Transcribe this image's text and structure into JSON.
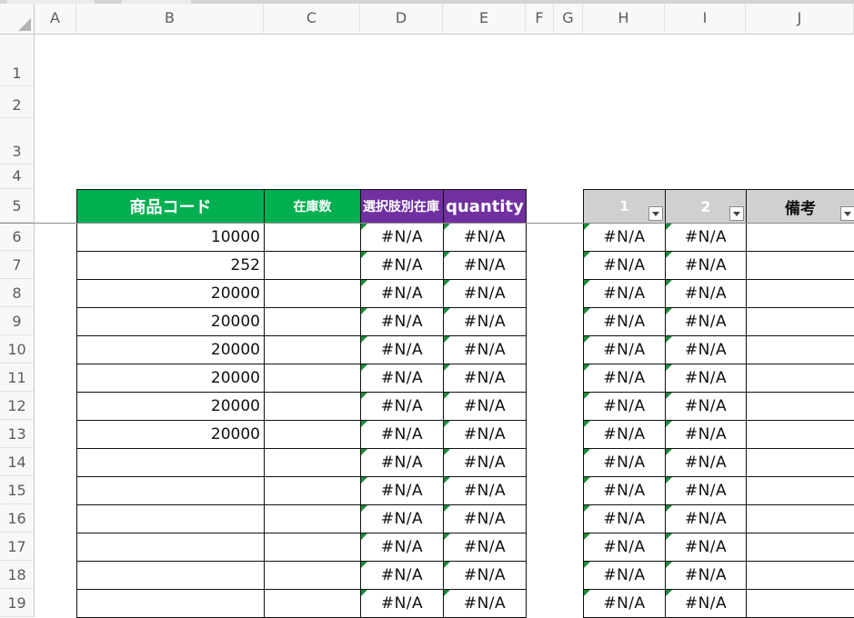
{
  "columns": [
    "A",
    "B",
    "C",
    "D",
    "E",
    "F",
    "G",
    "H",
    "I",
    "J"
  ],
  "rows": [
    "1",
    "2",
    "3",
    "4",
    "5",
    "6",
    "7",
    "8",
    "9",
    "10",
    "11",
    "12",
    "13",
    "14",
    "15",
    "16",
    "17",
    "18",
    "19"
  ],
  "table1": {
    "headers": {
      "product_code": "商品コード",
      "stock": "在庫数",
      "option_stock": "選択肢別在庫",
      "quantity": "quantity"
    },
    "product_codes": [
      "10000",
      "252",
      "20000",
      "20000",
      "20000",
      "20000",
      "20000",
      "20000",
      "",
      "",
      "",
      "",
      "",
      ""
    ],
    "stock_values": [
      "",
      "",
      "",
      "",
      "",
      "",
      "",
      "",
      "",
      "",
      "",
      "",
      "",
      ""
    ],
    "option_stock_values": [
      "#N/A",
      "#N/A",
      "#N/A",
      "#N/A",
      "#N/A",
      "#N/A",
      "#N/A",
      "#N/A",
      "#N/A",
      "#N/A",
      "#N/A",
      "#N/A",
      "#N/A",
      "#N/A"
    ],
    "quantity_values": [
      "#N/A",
      "#N/A",
      "#N/A",
      "#N/A",
      "#N/A",
      "#N/A",
      "#N/A",
      "#N/A",
      "#N/A",
      "#N/A",
      "#N/A",
      "#N/A",
      "#N/A",
      "#N/A"
    ]
  },
  "table2": {
    "headers": {
      "h": "1",
      "i": "2",
      "j": "備考"
    },
    "h_values": [
      "#N/A",
      "#N/A",
      "#N/A",
      "#N/A",
      "#N/A",
      "#N/A",
      "#N/A",
      "#N/A",
      "#N/A",
      "#N/A",
      "#N/A",
      "#N/A",
      "#N/A",
      "#N/A"
    ],
    "i_values": [
      "#N/A",
      "#N/A",
      "#N/A",
      "#N/A",
      "#N/A",
      "#N/A",
      "#N/A",
      "#N/A",
      "#N/A",
      "#N/A",
      "#N/A",
      "#N/A",
      "#N/A",
      "#N/A"
    ],
    "j_values": [
      "",
      "",
      "",
      "",
      "",
      "",
      "",
      "",
      "",
      "",
      "",
      "",
      "",
      ""
    ]
  },
  "colors": {
    "header_green": "#00b050",
    "header_purple": "#7030a0",
    "header_gray": "#d0d0d0",
    "error_flag": "#1e8a3a"
  }
}
